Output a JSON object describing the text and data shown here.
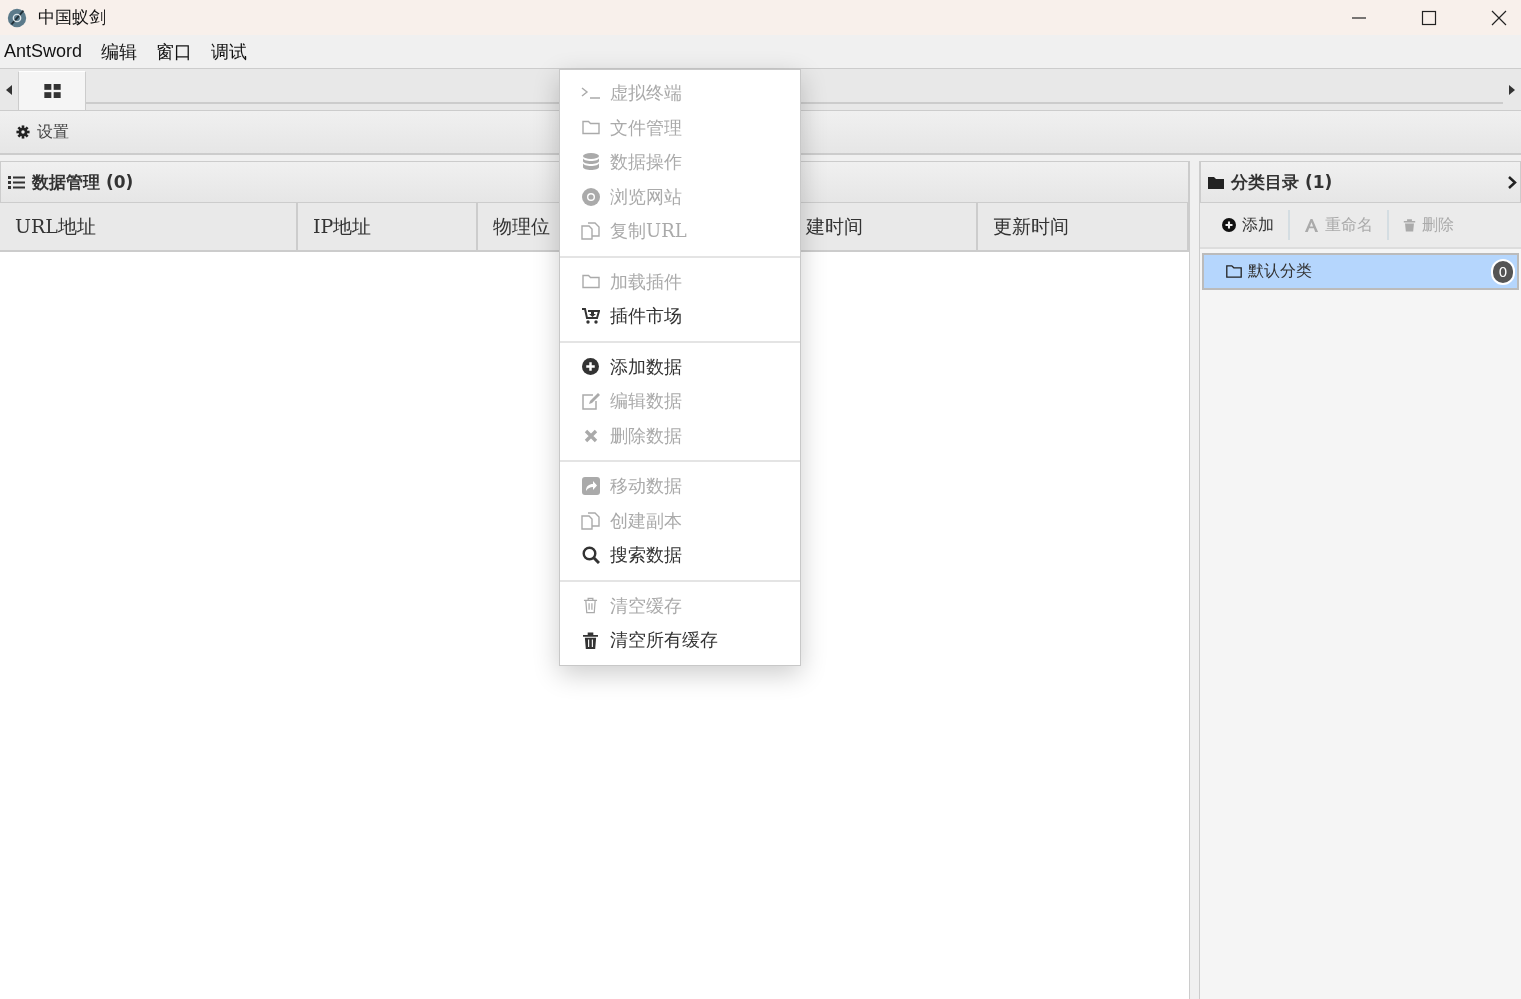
{
  "window": {
    "title": "中国蚁剑"
  },
  "menubar": [
    "AntSword",
    "编辑",
    "窗口",
    "调试"
  ],
  "tabs": [
    {
      "kind": "grid",
      "selected": true
    }
  ],
  "toolbar": {
    "settings": "设置"
  },
  "data_panel": {
    "title": "数据管理 (0)",
    "columns": [
      {
        "label": "URL地址"
      },
      {
        "label": "IP地址"
      },
      {
        "label": "物理位"
      },
      {
        "label": "建时间"
      },
      {
        "label": "更新时间"
      }
    ]
  },
  "category_panel": {
    "title": "分类目录 (1)",
    "buttons": [
      {
        "kind": "add",
        "label": "添加",
        "disabled": false
      },
      {
        "kind": "rename",
        "label": "重命名",
        "disabled": true
      },
      {
        "kind": "delete",
        "label": "删除",
        "disabled": true
      }
    ],
    "items": [
      {
        "label": "默认分类",
        "count": "0",
        "selected": true
      }
    ]
  },
  "context_menu": [
    [
      {
        "kind": "terminal",
        "label": "虚拟终端",
        "disabled": true
      },
      {
        "kind": "folder",
        "label": "文件管理",
        "disabled": true
      },
      {
        "kind": "database",
        "label": "数据操作",
        "disabled": true
      },
      {
        "kind": "browser",
        "label": "浏览网站",
        "disabled": true
      },
      {
        "kind": "copy",
        "label": "复制URL",
        "disabled": true
      }
    ],
    [
      {
        "kind": "folder",
        "label": "加载插件",
        "disabled": true
      },
      {
        "kind": "cart",
        "label": "插件市场",
        "disabled": false
      }
    ],
    [
      {
        "kind": "plus",
        "label": "添加数据",
        "disabled": false
      },
      {
        "kind": "edit",
        "label": "编辑数据",
        "disabled": true
      },
      {
        "kind": "cross",
        "label": "删除数据",
        "disabled": true
      }
    ],
    [
      {
        "kind": "share",
        "label": "移动数据",
        "disabled": true
      },
      {
        "kind": "copy",
        "label": "创建副本",
        "disabled": true
      },
      {
        "kind": "search",
        "label": "搜索数据",
        "disabled": false
      }
    ],
    [
      {
        "kind": "trash-outline",
        "label": "清空缓存",
        "disabled": true
      },
      {
        "kind": "trash",
        "label": "清空所有缓存",
        "disabled": false
      }
    ]
  ]
}
